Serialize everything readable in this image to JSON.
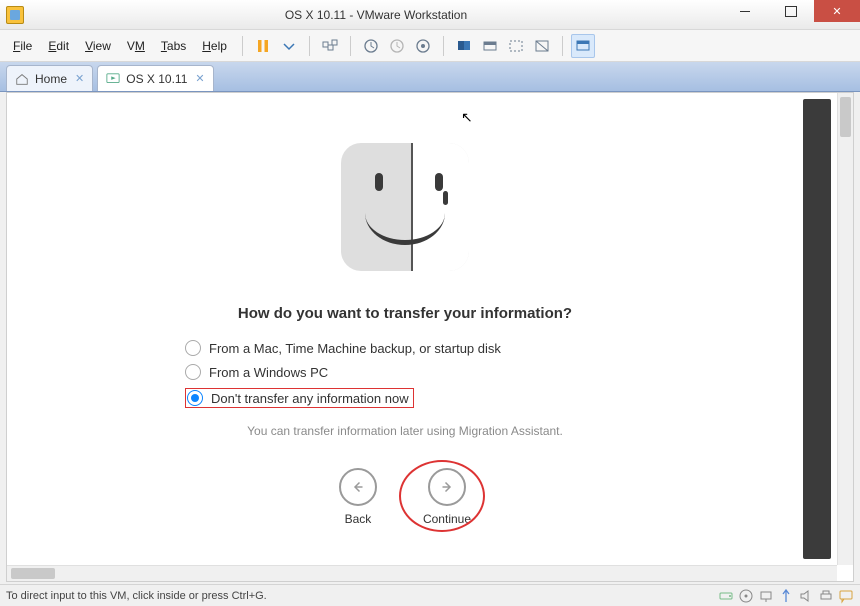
{
  "titlebar": {
    "title": "OS X 10.11 - VMware Workstation"
  },
  "menu": {
    "file": "File",
    "edit": "Edit",
    "view": "View",
    "vm": "VM",
    "tabs": "Tabs",
    "help": "Help"
  },
  "tabs": {
    "home_label": "Home",
    "vm_label": "OS X 10.11"
  },
  "guest": {
    "question": "How do you want to transfer your information?",
    "options": [
      {
        "label": "From a Mac, Time Machine backup, or startup disk",
        "selected": false
      },
      {
        "label": "From a Windows PC",
        "selected": false
      },
      {
        "label": "Don't transfer any information now",
        "selected": true
      }
    ],
    "later_note": "You can transfer information later using Migration Assistant.",
    "back_label": "Back",
    "continue_label": "Continue"
  },
  "statusbar": {
    "hint": "To direct input to this VM, click inside or press Ctrl+G."
  }
}
